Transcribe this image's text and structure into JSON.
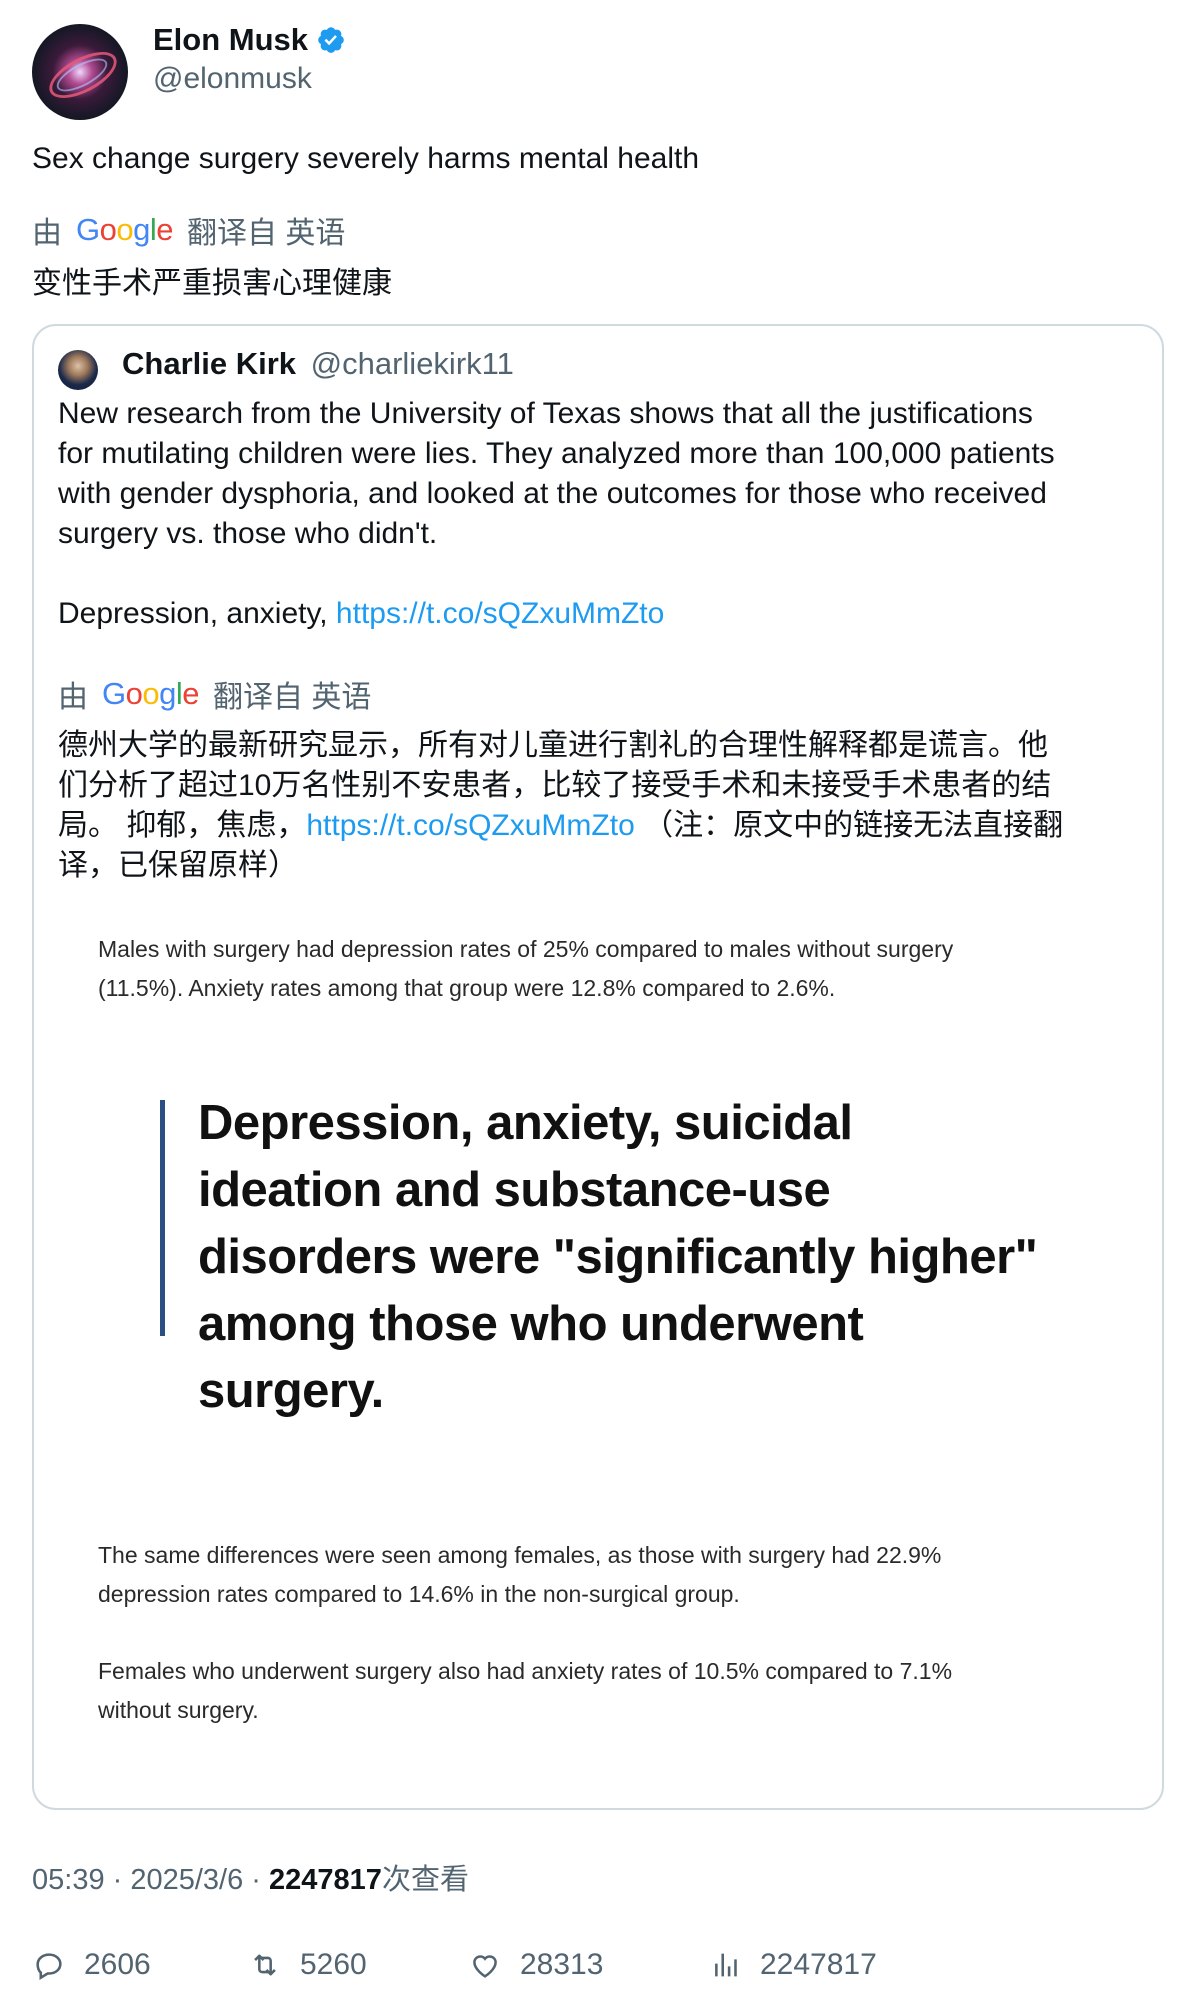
{
  "author": {
    "name": "Elon Musk",
    "handle": "@elonmusk",
    "verified": true,
    "avatar_icon": "avatar-galaxy"
  },
  "tweet": {
    "text": "Sex change surgery severely harms mental health",
    "translation_prefix": "由",
    "translation_provider": "Google",
    "translation_suffix": "翻译自 英语",
    "translation_text": "变性手术严重损害心理健康"
  },
  "quote": {
    "author_name": "Charlie Kirk",
    "author_handle": "@charliekirk11",
    "body_lines": [
      "New research from the University of Texas shows that all the justifications",
      "for mutilating children were lies. They analyzed more than 100,000 patients",
      "with gender dysphoria, and looked at the outcomes for those who received",
      "surgery vs. those who didn't."
    ],
    "body_second_text": "Depression, anxiety, ",
    "body_link": "https://t.co/sQZxuMmZto",
    "translation_prefix": "由",
    "translation_provider": "Google",
    "translation_suffix": "翻译自 英语",
    "translation_lines": [
      "德州大学的最新研究显示，所有对儿童进行割礼的合理性解释都是谎言。他",
      "们分析了超过10万名性别不安患者，比较了接受手术和未接受手术患者的结"
    ],
    "translation_line3_text": "局。 抑郁，焦虑，",
    "translation_link": "https://t.co/sQZxuMmZto",
    "translation_line3_tail": " （注：原文中的链接无法直接翻",
    "translation_line4": "译，已保留原样）",
    "image": {
      "para1_line1": "Males with surgery had depression rates of 25% compared to males without surgery",
      "para1_line2": "(11.5%). Anxiety rates among that group were 12.8% compared to 2.6%.",
      "pull_quote_lines": [
        "Depression, anxiety, suicidal",
        "ideation and substance-use",
        "disorders were \"significantly higher\"",
        "among those who underwent",
        "surgery."
      ],
      "para2_line1": "The same differences were seen among females, as those with surgery had 22.9%",
      "para2_line2": "depression rates compared to 14.6% in the non-surgical group.",
      "para3_line1": "Females who underwent surgery also had anxiety rates of 10.5% compared to 7.1%",
      "para3_line2": "without surgery."
    }
  },
  "meta": {
    "time": "05:39",
    "sep1": " · ",
    "date": "2025/3/6",
    "sep2": " · ",
    "views_count": "2247817",
    "views_label": "次查看"
  },
  "actions": {
    "replies": "2606",
    "retweets": "5260",
    "likes": "28313",
    "views": "2247817"
  },
  "colors": {
    "text_primary": "#0f1419",
    "text_secondary": "#536471",
    "link": "#1d9bf0",
    "verified": "#1d9bf0",
    "quote_bar": "#2b4f85"
  }
}
